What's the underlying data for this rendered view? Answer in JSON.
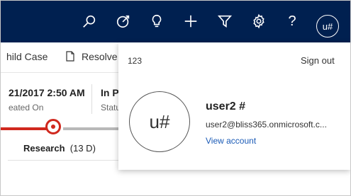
{
  "header": {
    "icons": [
      "search-icon",
      "target-icon",
      "lightbulb-icon",
      "plus-icon",
      "filter-icon",
      "gear-icon",
      "help-icon"
    ],
    "help_label": "?",
    "avatar_initials": "u#",
    "background_color": "#002050"
  },
  "commands": {
    "child_case_label": "hild Case",
    "resolve_label": "Resolve"
  },
  "record": {
    "created_on_value": "21/2017 2:50 AM",
    "created_on_label": "eated On",
    "status_value": "In P",
    "status_label": "Statu"
  },
  "process": {
    "stage_name": "Research",
    "stage_duration": "(13 D)",
    "accent_color": "#d0281e"
  },
  "account_flyout": {
    "org": "123",
    "sign_out_label": "Sign out",
    "avatar_initials": "u#",
    "user_name": "user2 #",
    "email": "user2@bliss365.onmicrosoft.c...",
    "view_account_label": "View account",
    "link_color": "#1a5ab6"
  }
}
